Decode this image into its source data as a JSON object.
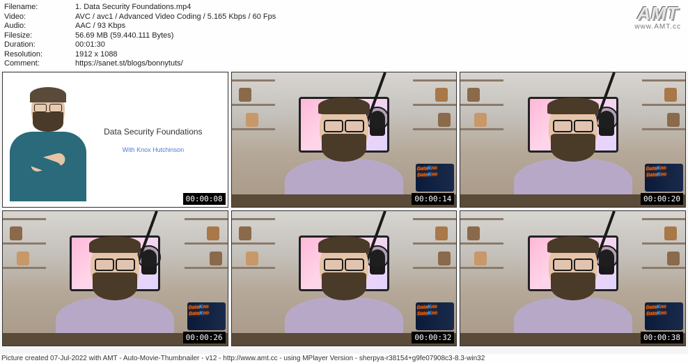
{
  "meta": {
    "filename_label": "Filename:",
    "filename_value": "1. Data Security Foundations.mp4",
    "video_label": "Video:",
    "video_value": "AVC / avc1 / Advanced Video Coding / 5.165 Kbps / 60 Fps",
    "audio_label": "Audio:",
    "audio_value": "AAC / 93 Kbps",
    "filesize_label": "Filesize:",
    "filesize_value": "56.69 MB (59.440.111 Bytes)",
    "duration_label": "Duration:",
    "duration_value": "00:01:30",
    "resolution_label": "Resolution:",
    "resolution_value": "1912 x 1088",
    "comment_label": "Comment:",
    "comment_value": "https://sanet.st/blogs/bonnytuts/"
  },
  "logo": {
    "text": "AMT",
    "url": "www.AMT.cc"
  },
  "slide": {
    "title": "Data Security Foundations",
    "subtitle": "With Knox Hutchinson"
  },
  "thumbnails": [
    {
      "timestamp": "00:00:08"
    },
    {
      "timestamp": "00:00:14"
    },
    {
      "timestamp": "00:00:20"
    },
    {
      "timestamp": "00:00:26"
    },
    {
      "timestamp": "00:00:32"
    },
    {
      "timestamp": "00:00:38"
    }
  ],
  "footer": {
    "text": "Picture created 07-Jul-2022 with AMT - Auto-Movie-Thumbnailer - v12 - http://www.amt.cc - using MPlayer Version - sherpya-r38154+g9fe07908c3-8.3-win32"
  }
}
